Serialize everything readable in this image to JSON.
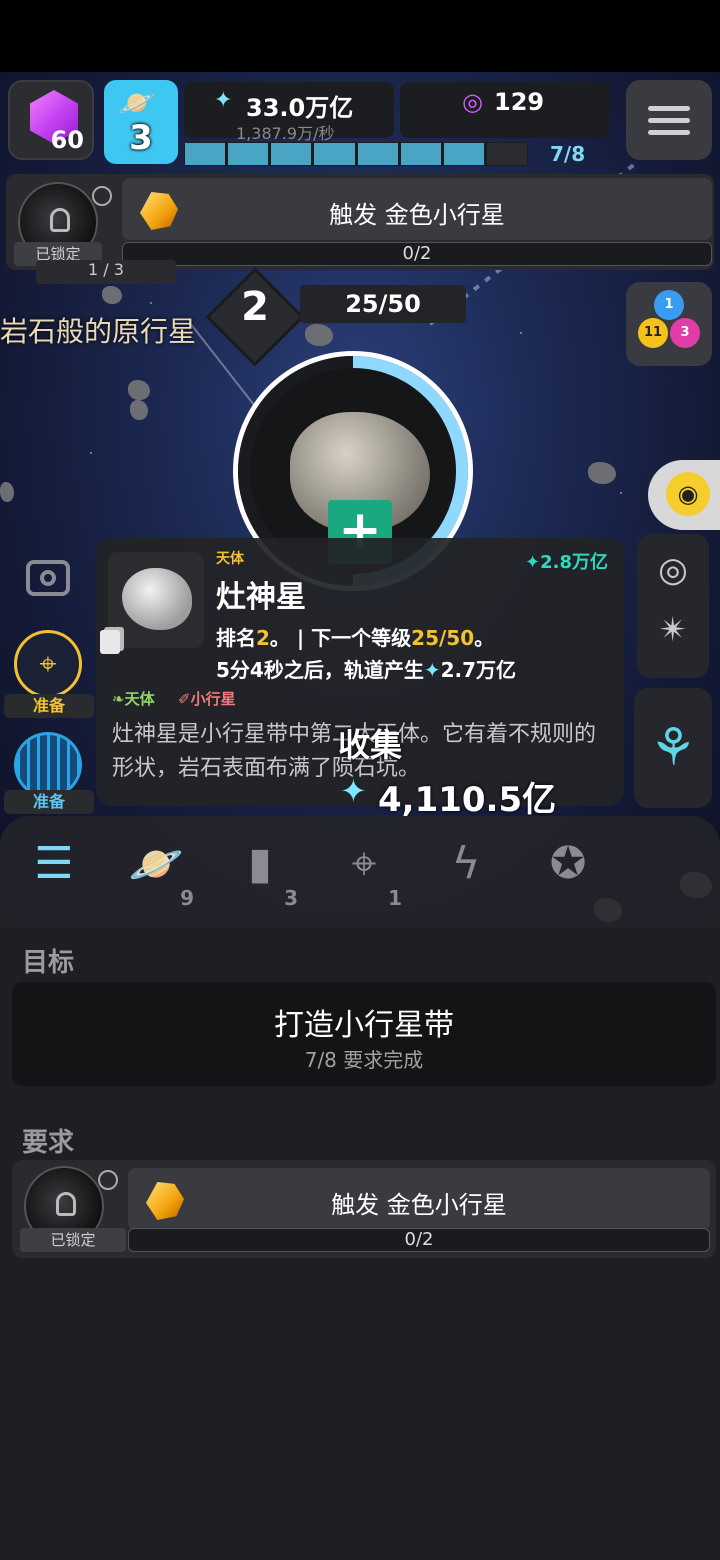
{
  "top": {
    "cube_count": "60",
    "planet_level": "3",
    "stardust": "33.0万亿",
    "stardust_rate": "1,387.9万/秒",
    "orbit_count": "129",
    "progress_label": "7/8",
    "progress": {
      "done": 7,
      "total": 8
    }
  },
  "lock_row": {
    "locked_label": "已锁定",
    "trigger_text": "触发 金色小行星",
    "trigger_progress": "0/2"
  },
  "level": {
    "number": "2",
    "progress": "25/50",
    "behind_bar": "1 / 3",
    "body_name": "岩石般的原行星",
    "ring_fill_fraction": 0.5
  },
  "orbs": {
    "a": "1",
    "b": "11",
    "c": "3"
  },
  "side": {
    "scope_label": "准备",
    "net_label": "准备"
  },
  "card": {
    "type": "天体",
    "value": "2.8万亿",
    "name": "灶神星",
    "rank_line_a": "排名",
    "rank": "2",
    "rank_line_b": "。 | 下一个等级",
    "next_level": "25/50",
    "rank_line_c": "。",
    "timer_line_a": "5分4秒之后，轨道产生",
    "timer_value": "2.7万亿",
    "tag1": "天体",
    "tag2": "小行星",
    "description": "灶神星是小行星带中第二大天体。它有着不规则的形状，岩石表面布满了陨石坑。"
  },
  "collect": {
    "label": "收集",
    "value": "4,110.5亿"
  },
  "tabs": [
    {
      "icon": "checklist-icon",
      "count": ""
    },
    {
      "icon": "planet-icon",
      "count": "9"
    },
    {
      "icon": "cards-icon",
      "count": "3"
    },
    {
      "icon": "telescope-icon",
      "count": "1"
    },
    {
      "icon": "lightning-icon",
      "count": ""
    },
    {
      "icon": "medal-icon",
      "count": ""
    }
  ],
  "goal": {
    "heading": "目标",
    "title": "打造小行星带",
    "subtitle": "7/8 要求完成"
  },
  "requirements": {
    "heading": "要求",
    "locked_label": "已锁定",
    "trigger_text": "触发 金色小行星",
    "trigger_progress": "0/2"
  }
}
